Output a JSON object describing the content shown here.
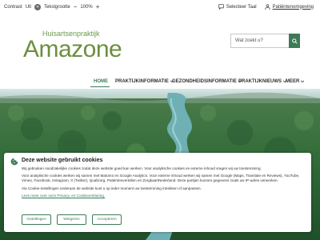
{
  "topbar": {
    "contrast_label": "Contrast",
    "contrast_value": "Uit",
    "textsize_label": "Tekstgrootte",
    "textsize_minus": "−",
    "textsize_value": "100%",
    "textsize_plus": "+",
    "language_label": "Selecteer Taal",
    "patient_portal_label": "Patiëntenomgeving"
  },
  "logo": {
    "subtitle": "Huisartsenpraktijk",
    "name": "Amazone"
  },
  "search": {
    "placeholder": "Wat zoekt u?"
  },
  "nav": {
    "items": [
      {
        "label": "HOME"
      },
      {
        "label": "PRAKTIJKINFORMATIE"
      },
      {
        "label": "GEZONDHEIDSINFORMATIE"
      },
      {
        "label": "PRAKTIJKNIEUWS"
      },
      {
        "label": "MEER"
      }
    ]
  },
  "cookie": {
    "title": "Deze website gebruikt cookies",
    "p1": "Wij gebruiken noodzakelijke cookies zodat deze website goed kan werken. Voor analytische cookies en externe inhoud vragen wij uw toestemming.",
    "p2": "Voor analytische cookies werken wij samen met Matomo en Google Analytics. Voor externe inhoud werken wij samen met Google (Maps, Translate en Reviews), YouTube, Vimeo, Facebook, Instagram, X (Twitter), Qualizorg, Patiëntenvertellen en ZorgkaartNederland. Deze partijen kunnen gegevens zoals uw IP-adres verwerken.",
    "p3": "Via Cookie-instellingen onderaan de website kunt u op ieder moment uw toestemming intrekken of aanpassen.",
    "link": "Lees meer over onze Privacy- en Cookieverklaring.",
    "buttons": {
      "settings": "Instellingen",
      "reject": "Weigeren",
      "accept": "Accepteren"
    }
  },
  "colors": {
    "brand_green": "#3d7b56",
    "logo_green": "#6d8e3e"
  }
}
